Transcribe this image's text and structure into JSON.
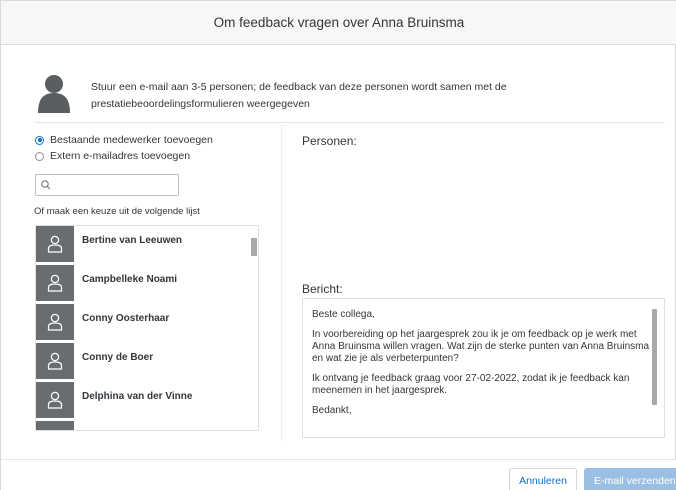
{
  "dialog": {
    "title": "Om feedback vragen over Anna Bruinsma"
  },
  "intro": {
    "text": "Stuur een e-mail aan 3-5 personen; de feedback van deze personen wordt samen met de prestatiebeoordelingsformulieren weergegeven"
  },
  "options": {
    "existing_employee": "Bestaande medewerker toevoegen",
    "external_email": "Extern e-mailadres toevoegen",
    "selected": "existing_employee"
  },
  "search": {
    "placeholder": "",
    "value": ""
  },
  "list": {
    "hint": "Of maak een keuze uit de volgende lijst",
    "people": [
      {
        "name": "Bertine van Leeuwen"
      },
      {
        "name": "Campbelleke Noami"
      },
      {
        "name": "Conny Oosterhaar"
      },
      {
        "name": "Conny de Boer"
      },
      {
        "name": "Delphina van der Vinne"
      }
    ]
  },
  "persons": {
    "label": "Personen:"
  },
  "message": {
    "label": "Bericht:",
    "paragraphs": [
      "Beste collega,",
      "In voorbereiding op het jaargesprek zou ik je om feedback op je werk met Anna Bruinsma willen vragen. Wat zijn de sterke punten van Anna Bruinsma en wat zie je als verbeterpunten?",
      "Ik ontvang je feedback graag voor 27-02-2022, zodat ik je feedback kan meenemen in het jaargesprek.",
      "Bedankt,"
    ]
  },
  "footer": {
    "cancel_label": "Annuleren",
    "send_label": "E-mail verzenden"
  },
  "colors": {
    "accent": "#0a6ed1",
    "avatar_bg": "#6a6d70",
    "disabled_button": "#9bbfe3"
  }
}
